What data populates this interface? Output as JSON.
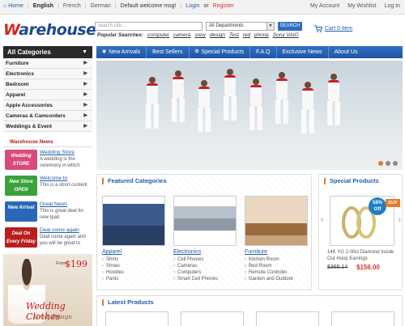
{
  "topbar": {
    "home": "Home",
    "languages": [
      "English",
      "French",
      "German"
    ],
    "welcome": "Default welcome msg!",
    "login": "Login",
    "or": "or",
    "register": "Register",
    "my_account": "My Account",
    "my_wishlist": "My Wishlist",
    "log_in": "Log In"
  },
  "header": {
    "logo_initial": "W",
    "logo_rest": "arehouse",
    "search_placeholder": "search site...",
    "department": "All Departments",
    "search_button": "SEARCH",
    "popular_label": "Popular Searches:",
    "popular_keywords": [
      "computer",
      "camera",
      "sony",
      "design",
      "Test",
      "red",
      "phone",
      "Sony VAIO"
    ],
    "cart": "Cart 0 item"
  },
  "categories": {
    "title": "All Categories",
    "items": [
      "Furniture",
      "Electronics",
      "Bedroom",
      "Apparel",
      "Apple Accessories",
      "Cameras & Camcorders",
      "Weddings & Event"
    ]
  },
  "news": {
    "title": "Warehouse News",
    "items": [
      {
        "thumb": "Wedding STORE",
        "title": "Wedding Store",
        "text": "A wedding is the ceremony in which",
        "color": "#d84a7a"
      },
      {
        "thumb": "New Store OPEN",
        "title": "Welcome to",
        "text": "This is a short content",
        "color": "#3aa23a"
      },
      {
        "thumb": "New Arrival",
        "title": "Great News",
        "text": "This is great deal for new Ipad",
        "color": "#2a67b8"
      },
      {
        "thumb": "Deal On Every Friday",
        "title": "Deal come again",
        "text": "Deal come again and you will be great to",
        "color": "#b81e1e"
      }
    ]
  },
  "promo": {
    "from": "From",
    "price": "$199",
    "line1": "Wedding Clothes",
    "line2": "Great Design"
  },
  "nav": {
    "tabs": [
      {
        "label": "New Arrivals",
        "icon": "rss-icon"
      },
      {
        "label": "Best Sellers",
        "icon": ""
      },
      {
        "label": "Special Products",
        "icon": "gift-icon"
      },
      {
        "label": "F.A.Q",
        "icon": ""
      },
      {
        "label": "Exclusive News",
        "icon": ""
      },
      {
        "label": "About Us",
        "icon": ""
      }
    ]
  },
  "featured": {
    "title": "Featured Categories",
    "columns": [
      {
        "name": "Apparel",
        "items": [
          "Shirts",
          "Shoes",
          "Hoodies",
          "Pants"
        ]
      },
      {
        "name": "Electronics",
        "items": [
          "Cell Phones",
          "Cameras",
          "Computers",
          "Smart Cell Phones"
        ]
      },
      {
        "name": "Furniture",
        "items": [
          "Kitchen Room",
          "Bed Room",
          "Remote Controler",
          "Garden and Outdoor"
        ]
      }
    ]
  },
  "special": {
    "title": "Special Products",
    "badge_pct": "58%",
    "badge_off": "Off",
    "buy": "BUY",
    "name": "14K YG 2.00ct Diamond Inside Out Hoop Earrings",
    "old_price": "$365.14",
    "new_price": "$156.00"
  },
  "latest": {
    "title": "Latest Products"
  },
  "colors": {
    "brand_red": "#d8261c",
    "brand_blue": "#1d4a8c",
    "nav_blue": "#2f70c4",
    "accent_orange": "#e57b2a",
    "price_red": "#d9322a"
  }
}
